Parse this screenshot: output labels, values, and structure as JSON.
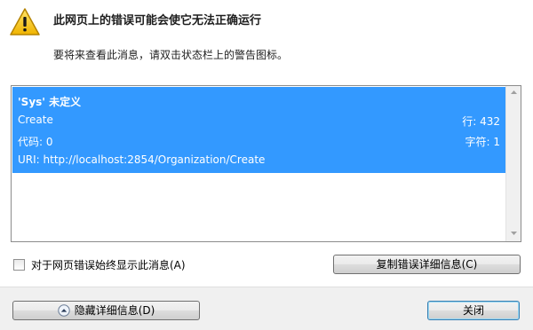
{
  "header": {
    "title": "此网页上的错误可能会使它无法正确运行",
    "subtitle": "要将来查看此消息，请双击状态栏上的警告图标。"
  },
  "error": {
    "name": "'Sys' 未定义",
    "function": "Create",
    "code_label": "代码: 0",
    "uri_label": "URI: http://localhost:2854/Organization/Create",
    "line_label": "行: 432",
    "char_label": "字符: 1"
  },
  "options": {
    "always_show_label": "对于网页错误始终显示此消息(A)",
    "always_show_checked": false
  },
  "buttons": {
    "copy_label": "复制错误详细信息(C)",
    "hide_details_label": "隐藏详细信息(D)",
    "close_label": "关闭"
  },
  "icons": {
    "warning": "warning-triangle-icon",
    "collapse": "chevron-up-circle-icon"
  },
  "colors": {
    "selection": "#3399ff",
    "warning_fill": "#f5c400",
    "footer_bg": "#f0f0f0"
  }
}
